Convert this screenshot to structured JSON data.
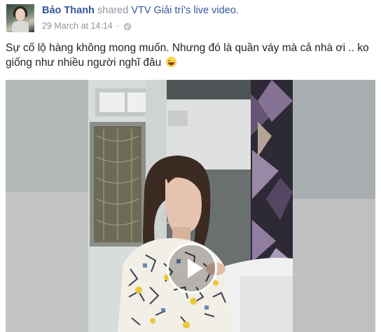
{
  "post": {
    "author_name": "Bảo Thanh",
    "action_text": "shared",
    "page_name": "VTV Giải trí",
    "possessive": "'s",
    "object_text": "live video.",
    "timestamp": "29 March at 14:14",
    "separator": "·",
    "privacy_icon": "globe-icon",
    "text_line1": "Sự cố lộ hàng không mong muốn. Nhưng đó là quần váy mà cả nhà ơi .. ko",
    "text_line2": "giống như nhiều người nghĩ đâu",
    "emoji_icon": "grinning-face-icon"
  },
  "video": {
    "play_icon": "play-icon"
  },
  "colors": {
    "link": "#365899",
    "muted": "#90949c",
    "text": "#1d2129"
  }
}
